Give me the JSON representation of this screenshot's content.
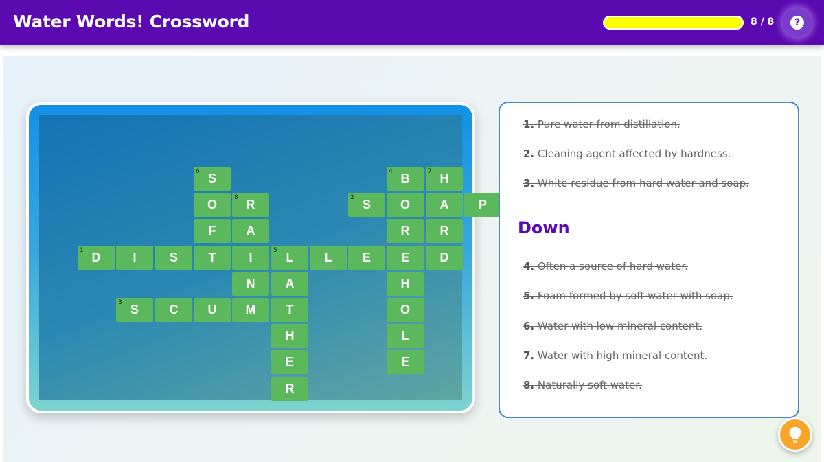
{
  "header": {
    "title": "Water Words! Crossword",
    "progress_fraction": 1.0,
    "progress_text": "8 / 8",
    "help_symbol": "?",
    "help_icon": "question-icon"
  },
  "colors": {
    "header_bg": "#5a0ab0",
    "progress_fill": "#ffff00",
    "cell_bg": "#5cb85c",
    "down_heading": "#5a0ab0",
    "hint_button": "#f7a52b"
  },
  "grid": {
    "cells": [
      {
        "r": 0,
        "c": 3,
        "letter": "S",
        "num": "6"
      },
      {
        "r": 0,
        "c": 8,
        "letter": "B",
        "num": "4"
      },
      {
        "r": 0,
        "c": 9,
        "letter": "H",
        "num": "7"
      },
      {
        "r": 1,
        "c": 3,
        "letter": "O",
        "num": ""
      },
      {
        "r": 1,
        "c": 4,
        "letter": "R",
        "num": "8"
      },
      {
        "r": 1,
        "c": 7,
        "letter": "S",
        "num": "2"
      },
      {
        "r": 1,
        "c": 8,
        "letter": "O",
        "num": ""
      },
      {
        "r": 1,
        "c": 9,
        "letter": "A",
        "num": ""
      },
      {
        "r": 1,
        "c": 10,
        "letter": "P",
        "num": ""
      },
      {
        "r": 2,
        "c": 3,
        "letter": "F",
        "num": ""
      },
      {
        "r": 2,
        "c": 4,
        "letter": "A",
        "num": ""
      },
      {
        "r": 2,
        "c": 8,
        "letter": "R",
        "num": ""
      },
      {
        "r": 2,
        "c": 9,
        "letter": "R",
        "num": ""
      },
      {
        "r": 3,
        "c": 0,
        "letter": "D",
        "num": "1"
      },
      {
        "r": 3,
        "c": 1,
        "letter": "I",
        "num": ""
      },
      {
        "r": 3,
        "c": 2,
        "letter": "S",
        "num": ""
      },
      {
        "r": 3,
        "c": 3,
        "letter": "T",
        "num": ""
      },
      {
        "r": 3,
        "c": 4,
        "letter": "I",
        "num": ""
      },
      {
        "r": 3,
        "c": 5,
        "letter": "L",
        "num": "5"
      },
      {
        "r": 3,
        "c": 6,
        "letter": "L",
        "num": ""
      },
      {
        "r": 3,
        "c": 7,
        "letter": "E",
        "num": ""
      },
      {
        "r": 3,
        "c": 8,
        "letter": "E",
        "num": ""
      },
      {
        "r": 3,
        "c": 9,
        "letter": "D",
        "num": ""
      },
      {
        "r": 4,
        "c": 4,
        "letter": "N",
        "num": ""
      },
      {
        "r": 4,
        "c": 5,
        "letter": "A",
        "num": ""
      },
      {
        "r": 4,
        "c": 8,
        "letter": "H",
        "num": ""
      },
      {
        "r": 5,
        "c": 1,
        "letter": "S",
        "num": "3"
      },
      {
        "r": 5,
        "c": 2,
        "letter": "C",
        "num": ""
      },
      {
        "r": 5,
        "c": 3,
        "letter": "U",
        "num": ""
      },
      {
        "r": 5,
        "c": 4,
        "letter": "M",
        "num": ""
      },
      {
        "r": 5,
        "c": 5,
        "letter": "T",
        "num": ""
      },
      {
        "r": 5,
        "c": 8,
        "letter": "O",
        "num": ""
      },
      {
        "r": 6,
        "c": 5,
        "letter": "H",
        "num": ""
      },
      {
        "r": 6,
        "c": 8,
        "letter": "L",
        "num": ""
      },
      {
        "r": 7,
        "c": 5,
        "letter": "E",
        "num": ""
      },
      {
        "r": 7,
        "c": 8,
        "letter": "E",
        "num": ""
      },
      {
        "r": 8,
        "c": 5,
        "letter": "R",
        "num": ""
      }
    ]
  },
  "clues": {
    "across": [
      {
        "num": "1.",
        "text": "Pure water from distillation.",
        "solved": true
      },
      {
        "num": "2.",
        "text": "Cleaning agent affected by hardness.",
        "solved": true
      },
      {
        "num": "3.",
        "text": "White residue from hard water and soap.",
        "solved": true
      }
    ],
    "down_heading": "Down",
    "down": [
      {
        "num": "4.",
        "text": "Often a source of hard water.",
        "solved": true
      },
      {
        "num": "5.",
        "text": "Foam formed by soft water with soap.",
        "solved": true
      },
      {
        "num": "6.",
        "text": "Water with low mineral content.",
        "solved": true
      },
      {
        "num": "7.",
        "text": "Water with high mineral content.",
        "solved": true
      },
      {
        "num": "8.",
        "text": "Naturally soft water.",
        "solved": true
      }
    ]
  },
  "hint": {
    "icon": "lightbulb-icon"
  }
}
